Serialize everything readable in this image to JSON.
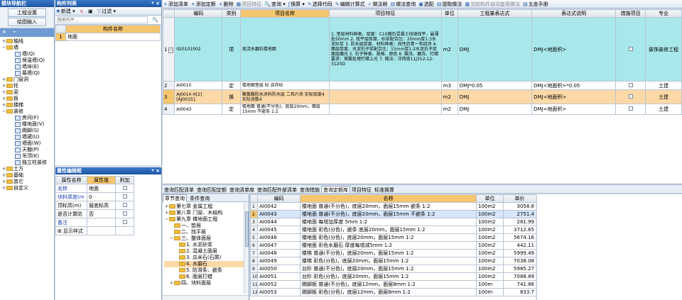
{
  "nav": {
    "title": "模块导航栏",
    "buttons": [
      "工程设置",
      "绘图输入"
    ],
    "add": "+",
    "remove": "−",
    "tree": [
      {
        "level": 0,
        "exp": "+",
        "icon": "folder",
        "label": "轴线"
      },
      {
        "level": 0,
        "exp": "−",
        "icon": "folder",
        "label": "墙"
      },
      {
        "level": 1,
        "exp": "",
        "icon": "sq",
        "label": "墙(Q)"
      },
      {
        "level": 1,
        "exp": "",
        "icon": "sq",
        "label": "保温墙(Q)"
      },
      {
        "level": 1,
        "exp": "",
        "icon": "sq",
        "label": "墙垛(E)"
      },
      {
        "level": 1,
        "exp": "",
        "icon": "sq",
        "label": "幕墙(Q)"
      },
      {
        "level": 0,
        "exp": "+",
        "icon": "folder",
        "label": "门窗洞"
      },
      {
        "level": 0,
        "exp": "+",
        "icon": "folder",
        "label": "柱"
      },
      {
        "level": 0,
        "exp": "+",
        "icon": "folder",
        "label": "梁"
      },
      {
        "level": 0,
        "exp": "+",
        "icon": "folder",
        "label": "板"
      },
      {
        "level": 0,
        "exp": "+",
        "icon": "folder",
        "label": "楼梯"
      },
      {
        "level": 0,
        "exp": "−",
        "icon": "folder",
        "label": "装修"
      },
      {
        "level": 1,
        "exp": "",
        "icon": "sq",
        "label": "房间(F)"
      },
      {
        "level": 1,
        "exp": "",
        "icon": "sq",
        "label": "楼地面(V)"
      },
      {
        "level": 1,
        "exp": "",
        "icon": "sq",
        "label": "踢脚(S)"
      },
      {
        "level": 1,
        "exp": "",
        "icon": "sq",
        "label": "墙裙(U)"
      },
      {
        "level": 1,
        "exp": "",
        "icon": "sq",
        "label": "墙面(W)"
      },
      {
        "level": 1,
        "exp": "",
        "icon": "sq",
        "label": "天棚(P)"
      },
      {
        "level": 1,
        "exp": "",
        "icon": "sq",
        "label": "吊顶(K)"
      },
      {
        "level": 1,
        "exp": "",
        "icon": "sq",
        "label": "独立柱装修"
      },
      {
        "level": 0,
        "exp": "+",
        "icon": "folder",
        "label": "土方"
      },
      {
        "level": 0,
        "exp": "+",
        "icon": "folder",
        "label": "基础"
      },
      {
        "level": 0,
        "exp": "+",
        "icon": "folder",
        "label": "其它"
      },
      {
        "level": 0,
        "exp": "+",
        "icon": "folder",
        "label": "自定义"
      }
    ]
  },
  "components": {
    "title": "构件列表",
    "new": "新建",
    "delete": "×",
    "filter": "过滤",
    "search_placeholder": "搜索构件...",
    "header": "构件名称",
    "rows": [
      {
        "num": "1",
        "name": "地面"
      }
    ]
  },
  "props": {
    "title": "属性编辑框",
    "headers": [
      "属性名称",
      "属性值",
      "附加"
    ],
    "rows": [
      {
        "name": "名称",
        "value": "地面",
        "extra": false,
        "blue": true
      },
      {
        "name": "块料厚度(m",
        "value": "0",
        "extra": true,
        "blue": true
      },
      {
        "name": "顶标高(m)",
        "value": "层底标高",
        "extra": true,
        "blue": false
      },
      {
        "name": "是否计算防",
        "value": "否",
        "extra": true,
        "blue": false
      },
      {
        "name": "备注",
        "value": "",
        "extra": true,
        "blue": true
      },
      {
        "name": "显示样式",
        "value": "",
        "extra": null,
        "blue": false,
        "plus": true
      }
    ]
  },
  "toolbar": [
    {
      "icon": "+",
      "label": "添加清单"
    },
    {
      "icon": "+",
      "label": "添加定额"
    },
    {
      "icon": "×",
      "label": "删除"
    },
    {
      "icon": "▦",
      "label": "项目特征",
      "dis": true
    },
    {
      "icon": "🔍",
      "label": "查询 ▾"
    },
    {
      "icon": "ƒ",
      "label": "换算 ▾"
    },
    {
      "icon": "✎",
      "label": "选择代码"
    },
    {
      "icon": "✎",
      "label": "编辑计算式"
    },
    {
      "icon": "✓",
      "label": "做法刷"
    },
    {
      "icon": "▤",
      "label": "做法查询"
    },
    {
      "icon": "▣",
      "label": "选配"
    },
    {
      "icon": "▤",
      "label": "提取做法"
    },
    {
      "icon": "▦",
      "label": "当前构件自动套用做法",
      "dis": true
    },
    {
      "icon": "▤",
      "label": "五金手册"
    }
  ],
  "main_grid": {
    "headers": [
      "",
      "编码",
      "类别",
      "项目名称",
      "项目特征",
      "单位",
      "工程量表达式",
      "表达式说明",
      "措施项目",
      "专业"
    ],
    "rows": [
      {
        "num": "1",
        "exp": "−",
        "code": "020101002",
        "type": "项",
        "name": "现浇水磨石楼地面",
        "feature": "1. 垫层材料种类、厚度：C10细石混凝土找坡找平，最薄处50mm 2. 找平层厚度、砂浆配合比：20mm厚1:3水泥砂浆 3. 防水层厚度、材料种类：改性沥青一布四涂 4. 面层厚度、水泥石子浆配合比：15mm厚1:2水泥石子浆面层磨光 5. 石子种类、规格、颜色 6. 酸洗、磨洗、打蜡要求：草酸处理打蜡上光 7. 做法：详西南11J312-12-3120D",
        "unit": "m2",
        "expr": "DMJ",
        "desc": "DMJ<地面积>",
        "measure": false,
        "major": "装饰装修工程",
        "main": true
      },
      {
        "num": "2",
        "exp": "",
        "code": "AI0010",
        "type": "定",
        "name": "楼地面垫层 砼 自拌砼",
        "feature": "",
        "unit": "m3",
        "expr": "DMJ*0.05",
        "desc": "DMJ<地面积>*0.05",
        "measure": false,
        "major": "土建"
      },
      {
        "num": "3",
        "exp": "",
        "code": "AJ0014 H[2][AJ0015],",
        "type": "换",
        "name": "聚氨酯防水涂料防水层 二布六涂 实际厚度4 实际涂数4",
        "feature": "",
        "unit": "m2",
        "expr": "DMJ",
        "desc": "DMJ<地面积>",
        "measure": false,
        "major": "土建",
        "sel": true
      },
      {
        "num": "4",
        "exp": "",
        "code": "AI0043",
        "type": "定",
        "name": "楼地面 普通(不分色)，底层20mm，面层15mm 不嵌条 1:2",
        "feature": "",
        "unit": "m2",
        "expr": "DMJ",
        "desc": "DMJ<地面积>",
        "measure": false,
        "major": "土建"
      }
    ]
  },
  "bottom_tabs": [
    "查询匹配清单",
    "查询匹配定额",
    "查询清单库",
    "查询匹配外部清单",
    "查询措施",
    "查询定额库",
    "项目特征",
    "标准换算"
  ],
  "bottom_active": 5,
  "chapter_tabs": [
    "章节查询",
    "条件查询"
  ],
  "chapter_tree": [
    {
      "level": 1,
      "exp": "+",
      "label": "第七章 金属工程"
    },
    {
      "level": 1,
      "exp": "+",
      "label": "第八章 门窗、木结构"
    },
    {
      "level": 1,
      "exp": "−",
      "label": "第九章 楼地面工程"
    },
    {
      "level": 2,
      "exp": "",
      "label": "一、垫层"
    },
    {
      "level": 2,
      "exp": "",
      "label": "二、找平层"
    },
    {
      "level": 2,
      "exp": "−",
      "label": "三、整体面层"
    },
    {
      "level": 3,
      "exp": "",
      "label": "1. 水泥砂浆"
    },
    {
      "level": 3,
      "exp": "",
      "label": "2. 混凝土面层"
    },
    {
      "level": 3,
      "exp": "",
      "label": "3. 瓜米石(石屑)"
    },
    {
      "level": 3,
      "exp": "",
      "label": "4. 水磨石",
      "sel": true
    },
    {
      "level": 3,
      "exp": "",
      "label": "5. 防滑条、嵌条"
    },
    {
      "level": 3,
      "exp": "",
      "label": "6. 面层打蜡"
    },
    {
      "level": 2,
      "exp": "+",
      "label": "四、块料面层"
    }
  ],
  "quota": {
    "headers": [
      "",
      "编码",
      "名称",
      "单位",
      "单价"
    ],
    "rows": [
      {
        "n": "1",
        "code": "AI0042",
        "name": "楼地面 普通(不分色)，底层20mm，面层15mm 嵌条 1:2",
        "unit": "100m2",
        "price": "3058.8"
      },
      {
        "n": "2",
        "code": "AI0043",
        "name": "楼地面 普通(不分色)，底层20mm，面层15mm 不嵌条 1:2",
        "unit": "100m2",
        "price": "2751.4",
        "sel": true
      },
      {
        "n": "3",
        "code": "AI0044",
        "name": "楼地面 每增加厚度 5mm 1:2",
        "unit": "100m2",
        "price": "281.99"
      },
      {
        "n": "4",
        "code": "AI0045",
        "name": "楼地面 彩色(分色)，嵌条 底层20mm，面层15mm 1:2",
        "unit": "100m2",
        "price": "3712.65"
      },
      {
        "n": "5",
        "code": "AI0046",
        "name": "楼地面 彩色(分色)，底层20mm，面层15mm 1:2",
        "unit": "100m2",
        "price": "5674.16"
      },
      {
        "n": "6",
        "code": "AI0047",
        "name": "楼地面 彩色水磨石 厚度每增减5mm 1:2",
        "unit": "100m2",
        "price": "442.11"
      },
      {
        "n": "7",
        "code": "AI0048",
        "name": "楼梯 普通(不分色)，底层20mm，面层15mm 1:2",
        "unit": "100m2",
        "price": "5999.49"
      },
      {
        "n": "8",
        "code": "AI0049",
        "name": "楼梯 彩色(分色)，底层20mm，面层15mm 1:2",
        "unit": "100m2",
        "price": "7038.08"
      },
      {
        "n": "9",
        "code": "AI0050",
        "name": "台阶 普通(不分色)，底层20mm，面层15mm 1:2",
        "unit": "100m2",
        "price": "5985.27"
      },
      {
        "n": "10",
        "code": "AI0051",
        "name": "台阶 彩色(分色)，底层20mm，面层15mm 1:2",
        "unit": "100m2",
        "price": "7088.89"
      },
      {
        "n": "11",
        "code": "AI0052",
        "name": "踢脚板 普通(不分色)，底层12mm，面层8mm 1:2",
        "unit": "100m",
        "price": "741.86"
      },
      {
        "n": "12",
        "code": "AI0053",
        "name": "踢脚板 彩色(分色)，底层12mm，面层8mm 1:2",
        "unit": "100m",
        "price": "833.7"
      }
    ]
  },
  "colors": {
    "title_blue": "#1d55a6",
    "main_row": "#a8e7ea",
    "selected": "#fdd9a8",
    "header_hl": "#f5c66e"
  }
}
